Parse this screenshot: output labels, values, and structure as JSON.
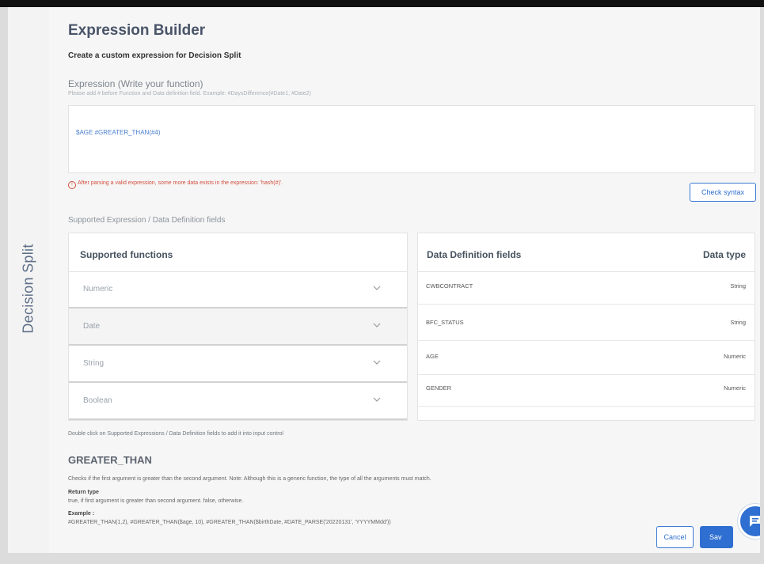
{
  "sidebar": {
    "title": "Decision Split"
  },
  "header": {
    "title": "Expression Builder",
    "subtitle": "Create a custom expression for Decision Split"
  },
  "expression": {
    "label": "Expression (Write your function)",
    "hint": "Please add # before Function and Data definition field. Example: #DaysDifference(#Date1, #Date2)",
    "value": "$AGE #GREATER_THAN(#4)",
    "error": "After parsing a valid expression, some more data exists in the expression: 'hash(#)'.",
    "check_syntax_label": "Check syntax"
  },
  "supported_section": {
    "label": "Supported Expression / Data Definition fields"
  },
  "functions_panel": {
    "title": "Supported functions",
    "items": [
      {
        "label": "Numeric"
      },
      {
        "label": "Date"
      },
      {
        "label": "String"
      },
      {
        "label": "Boolean"
      }
    ]
  },
  "fields_panel": {
    "title": "Data Definition fields",
    "type_header": "Data type",
    "rows": [
      {
        "name": "CWBCONTRACT",
        "type": "String"
      },
      {
        "name": "BFC_STATUS",
        "type": "String"
      },
      {
        "name": "AGE",
        "type": "Numeric"
      },
      {
        "name": "GENDER",
        "type": "Numeric"
      }
    ]
  },
  "hint_text": "Double click on Supported Expressions / Data Definition fields to add it into input control",
  "function_doc": {
    "name": "GREATER_THAN",
    "description": "Checks if the first argument is greater than the second argument. Note: Although this is a generic function, the type of all the arguments must match.",
    "return_label": "Return type",
    "return_text": "true, if first argument is greater than second argument. false, otherwise.",
    "example_label": "Example :",
    "example_text": "#GREATER_THAN(1,2), #GREATER_THAN($age, 10), #GREATER_THAN($birthDate, #DATE_PARSE('20220131', 'YYYYMMdd'))"
  },
  "footer": {
    "cancel_label": "Cancel",
    "save_label": "Sav"
  },
  "colors": {
    "accent": "#2f6fd1",
    "error": "#d2503f",
    "title": "#495468"
  }
}
